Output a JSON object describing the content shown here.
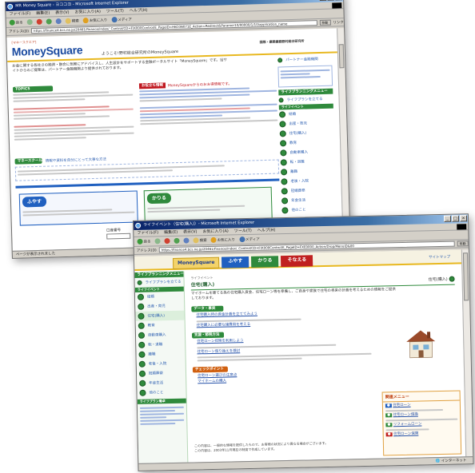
{
  "window1": {
    "title": "MR Money Square - ヨココヨ - Microsoft Internet Explorer",
    "menu": [
      "ファイル(F)",
      "編集(E)",
      "表示(V)",
      "お気に入り(A)",
      "ツール(T)",
      "ヘルプ(H)"
    ],
    "toolbar": [
      "戻る",
      "検索",
      "お気に入り",
      "メディア"
    ],
    "address_label": "アドレス(D)",
    "address": "https://finance4.bcs.ne.jp/20461/finance/index/_Control/CD=FIX000Control/E_PageID=HKC0N071E_Action=Redirect&Paramer10/00000/1/10/application_name",
    "go_label": "移動",
    "links_label": "リンク",
    "logo_main": "MoneySquare",
    "logo_sub": "[マネースクエア]",
    "welcome": "ようこそ!野村総合研究所のMoneySquare",
    "header_right": "国際・業務業務野村総合研究所",
    "partner_link": "パートナー金融機関",
    "intro": "お金に関する各社さの融資・融合に気軽にアドバイスし、人生設計をサポートする金融ポータルサイト「MoneySquare」です。当サイトからのご提案は、パートナー金融機関より提供されております。",
    "left_tab": "TOPICS",
    "featured_heading": "お役立ち情報",
    "featured_tag": "MoneySquareからのおお得情報です。",
    "lifeplan_menu": "ライフプランニングメニュー",
    "lifeplan_item": "ライフプランを立てる",
    "life_events_label": "ライフイベント",
    "life_events": [
      "結婚",
      "出産・育児",
      "住宅(購入)",
      "教育",
      "自動車購入",
      "転・退職",
      "離職",
      "老後・入院",
      "冠婚葬祭",
      "年金生活",
      "他のこと"
    ],
    "money_school": "マネースクール",
    "money_school_sub": "情報や資料を自分にとって大事な方法",
    "yasu": "ふやす",
    "kariru": "かりる",
    "account_label": "口座番号",
    "login_label": "ログイン",
    "status": "ページが表示されました"
  },
  "window2": {
    "title": "ライフイベント（住宅(購入)）- Microsoft Internet Explorer",
    "menu": [
      "ファイル(F)",
      "編集(E)",
      "表示(V)",
      "お気に入り(A)",
      "ツール(T)",
      "ヘルプ(H)"
    ],
    "toolbar": [
      "戻る",
      "検索",
      "お気に入り",
      "メディア"
    ],
    "address_label": "アドレス(D)",
    "address": "https://finance4.bcs.ne.jp/20461/finance/index/_Control/CD=FIX000Control/E_PageID=FXE0000_Action/Drop/MenuID&00",
    "go_label": "移動",
    "tabs": [
      "MoneySquare",
      "ふやす",
      "かりる",
      "そなえる"
    ],
    "tab_colors": [
      "#e8b820",
      "#2060c0",
      "#2f8a3c",
      "#c02020"
    ],
    "header_link": "サイトマップ",
    "sidebar_heading": "ライフプランニングメニュー",
    "sidebar_item": "ライフプランを立てる",
    "life_events_label": "ライフイベント",
    "life_events": [
      "結婚",
      "出産・育児",
      "住宅(購入)",
      "教育",
      "自動車購入",
      "転・退職",
      "離職",
      "老後・入院",
      "冠婚葬祭",
      "年金生活",
      "他のこと"
    ],
    "life_tools_label": "ライフプラン電卓",
    "breadcrumb": "ライフイベント",
    "page_title": "住宅(購入)",
    "page_title_right": "住宅(購入)",
    "lead": "マイホームを建てる為の住宅購入資金、住宅ローン等を準備し、ご自身や家族で住宅の将来の計画を考えるための情報をご提供しております。",
    "sections": [
      {
        "label": "データ・事実",
        "items": [
          "住宅購入時の資金計画を立ててみよう",
          "住宅購入に必要な諸費用を考える"
        ]
      },
      {
        "label": "支援・節税方法",
        "items": [
          "住宅ローン控除を利用しよう",
          "住宅ローン借り換えを検討"
        ]
      },
      {
        "label": "チェックポイント",
        "items": [
          "住宅ローン選びの注意点",
          "マイホームの購入"
        ]
      }
    ],
    "related_menu": "関連メニュー",
    "related_items": [
      "住宅ローン",
      "住宅ローン借換",
      "リフォームローン",
      "住宅ローン保険"
    ],
    "footer_note": "この内容は、一般的な情報を提供したもので、お客様の状況により異なる場合がございます。",
    "footer_note2": "この内容は、2003年11月現在の制度で作成しています。",
    "status": "インターネット"
  }
}
